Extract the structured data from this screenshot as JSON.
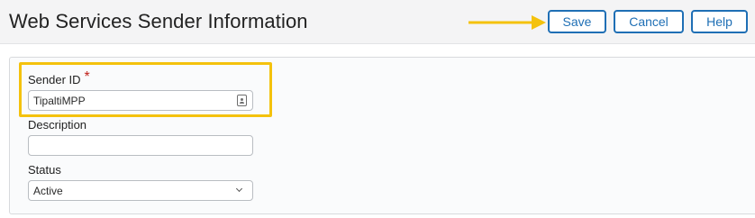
{
  "header": {
    "title": "Web Services Sender Information",
    "buttons": {
      "save_label": "Save",
      "cancel_label": "Cancel",
      "help_label": "Help"
    }
  },
  "form": {
    "sender_id": {
      "label": "Sender ID",
      "required_marker": "*",
      "value": "TipaltiMPP"
    },
    "description": {
      "label": "Description",
      "value": ""
    },
    "status": {
      "label": "Status",
      "selected": "Active"
    }
  },
  "colors": {
    "accent": "#1f6fb5",
    "annotation": "#f4c20d",
    "required": "#c0211a"
  }
}
